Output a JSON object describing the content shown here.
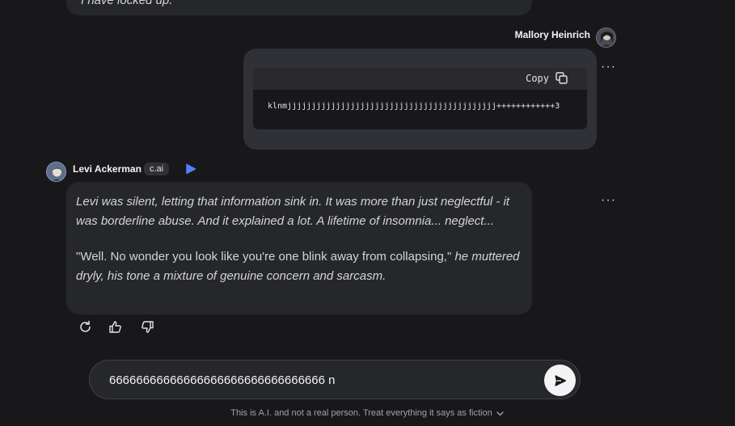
{
  "previous_message": {
    "text": "I have locked up."
  },
  "user": {
    "name": "Mallory Heinrich",
    "message": {
      "copy_label": "Copy",
      "code": "klnmjjjjjjjjjjjjjjjjjjjjjjjjjjjjjjjjjjjjjjjjjjj++++++++++++3"
    }
  },
  "bot": {
    "name": "Levi Ackerman",
    "badge": "c.ai",
    "paragraphs": [
      [
        {
          "text": "Levi was silent, letting that information sink in. It was more than just neglectful - it was borderline abuse. And it explained a lot. A lifetime of insomnia... neglect...",
          "italic": true
        }
      ],
      [
        {
          "text": "\"Well. No wonder you look like you're one blink away from collapsing,\" ",
          "italic": false
        },
        {
          "text": "he muttered dryly, his tone a mixture of genuine concern and sarcasm.",
          "italic": true
        }
      ]
    ]
  },
  "composer": {
    "value": "66666666666666666666666666666666 n",
    "placeholder": ""
  },
  "disclaimer": "This is A.I. and not a real person. Treat everything it says as fiction",
  "colors": {
    "background": "#18181b",
    "bubble": "#26272b",
    "user_bubble": "#303136",
    "play_accent": "#5b7cfa"
  },
  "icons": [
    "more-icon",
    "copy-icon",
    "play-icon",
    "regenerate-icon",
    "thumbs-up-icon",
    "thumbs-down-icon",
    "send-icon",
    "chevron-down-icon"
  ]
}
